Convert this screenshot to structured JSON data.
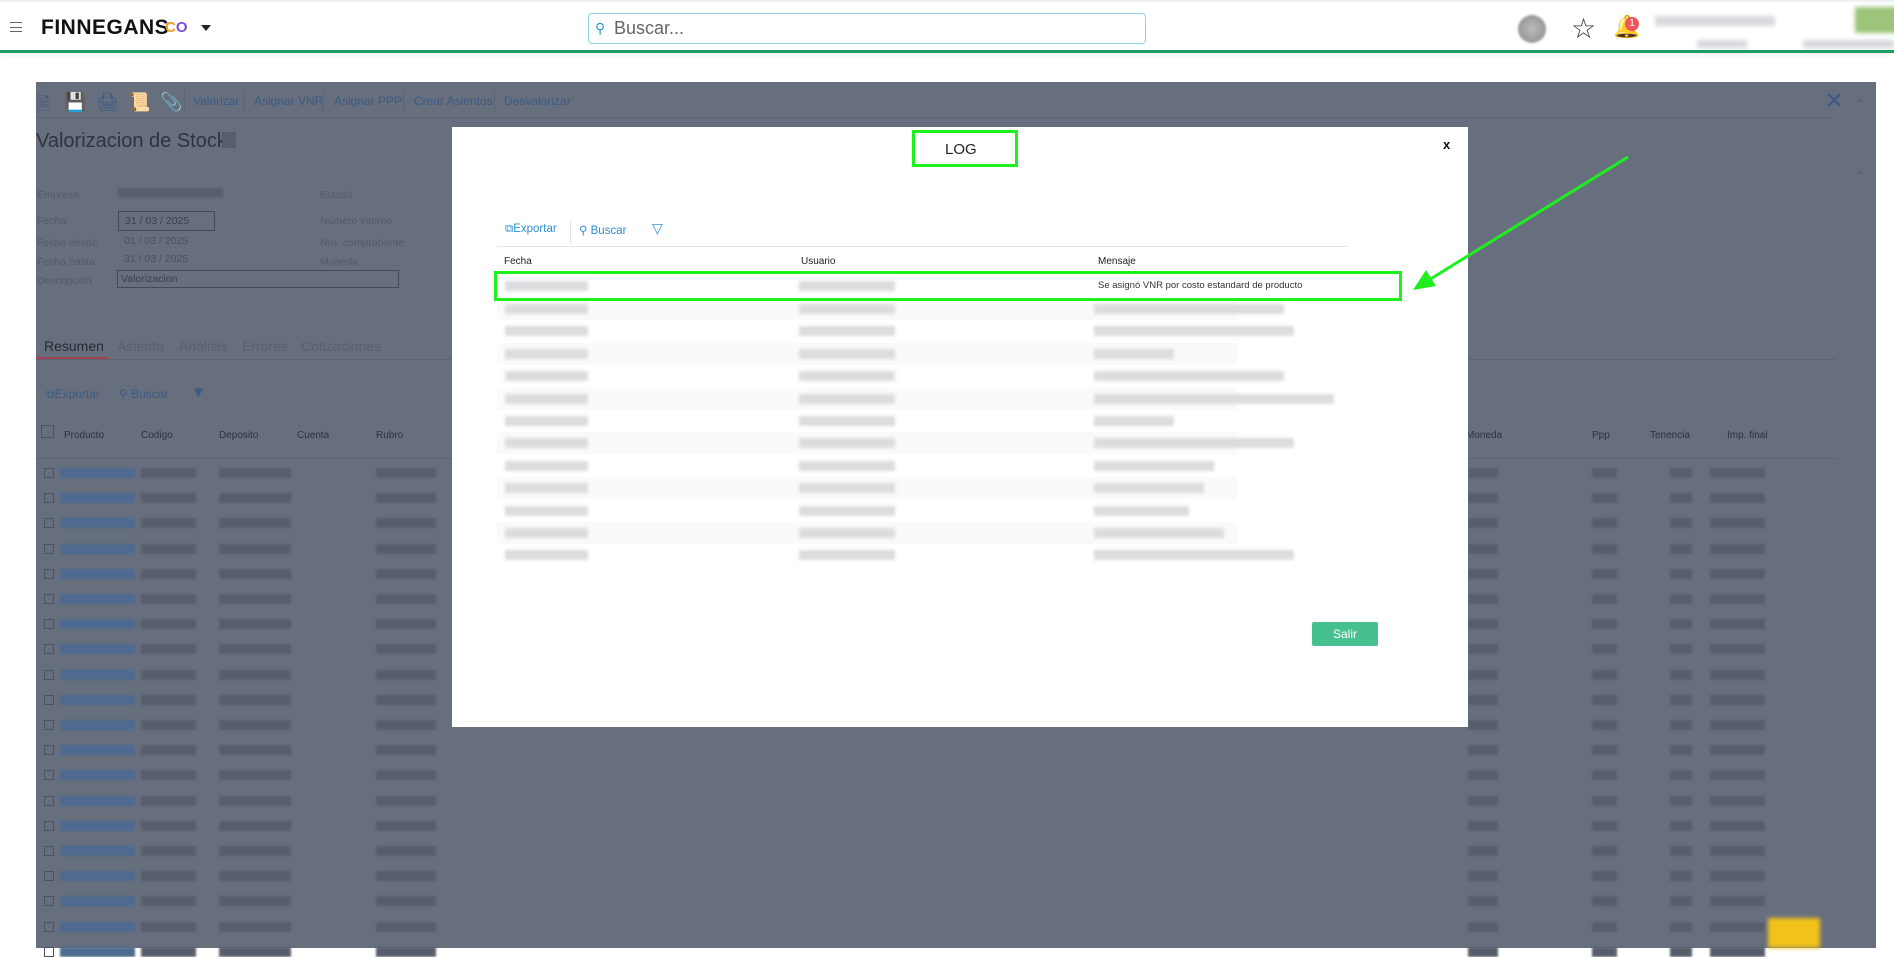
{
  "header": {
    "brand": "FINNEGANS",
    "brand_mark_c": "C",
    "brand_mark_o": "O",
    "search_placeholder": "Buscar...",
    "notifications": "1"
  },
  "background": {
    "toolbar": [
      "Valorizar",
      "Asignar VNR",
      "Asignar PPP",
      "Crear Asientos",
      "Desvalorizar"
    ],
    "title": "Valorizacion de Stock",
    "form": {
      "empresa": "Empresa",
      "fecha": "Fecha",
      "fecha_value": "31 / 03 / 2025",
      "fecha_desde": "Fecha desde",
      "fecha_desde_value": "01 / 03 / 2025",
      "fecha_hasta": "Fecha hasta",
      "fecha_hasta_value": "31 / 03 / 2025",
      "descripcion": "Descripción",
      "descripcion_value": "Valorizacion",
      "estado": "Estado",
      "numero_interno": "Número interno",
      "nro_comprobante": "Nro. comprobante",
      "moneda": "Moneda"
    },
    "tabs": [
      "Resumen",
      "Asiento",
      "Análisis",
      "Errores",
      "Cotizaciones"
    ],
    "grid_toolbar": {
      "exportar": "Exportar",
      "buscar": "Buscar"
    },
    "columns": [
      "Producto",
      "Codigo",
      "Deposito",
      "Cuenta",
      "Rubro",
      "Moneda",
      "Ppp",
      "Tenencia",
      "Imp. final"
    ]
  },
  "modal": {
    "title": "LOG",
    "close": "x",
    "toolbar": {
      "exportar": "Exportar",
      "buscar": "Buscar"
    },
    "columns": [
      "Fecha",
      "Usuario",
      "Mensaje"
    ],
    "first_row_message": "Se asignó VNR por costo estandard de producto",
    "exit": "Salir"
  },
  "colors": {
    "accent_green": "#1f9d63",
    "button": "#47c08f",
    "highlight": "#1ef01e",
    "link": "#2f8fd3"
  }
}
